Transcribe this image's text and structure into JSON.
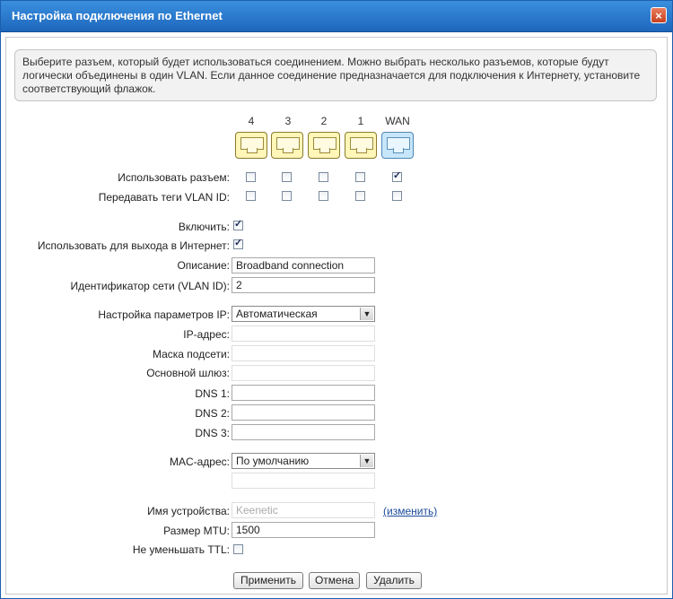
{
  "window": {
    "title": "Настройка подключения по Ethernet",
    "close_label": "×"
  },
  "info": "Выберите разъем, который будет использоваться соединением. Можно выбрать несколько разъемов, которые будут логически объединены в один VLAN. Если данное соединение предназначается для подключения к Интернету, установите соответствующий флажок.",
  "ports": [
    {
      "label": "4",
      "use": false,
      "vlan_tag": false
    },
    {
      "label": "3",
      "use": false,
      "vlan_tag": false
    },
    {
      "label": "2",
      "use": false,
      "vlan_tag": false
    },
    {
      "label": "1",
      "use": false,
      "vlan_tag": false
    },
    {
      "label": "WAN",
      "use": true,
      "vlan_tag": false
    }
  ],
  "labels": {
    "use_port": "Использовать разъем:",
    "vlan_tags": "Передавать теги VLAN ID:",
    "enable": "Включить:",
    "internet": "Использовать для выхода в Интернет:",
    "description": "Описание:",
    "vlan_id": "Идентификатор сети (VLAN ID):",
    "ip_settings": "Настройка параметров IP:",
    "ip_address": "IP-адрес:",
    "subnet_mask": "Маска подсети:",
    "gateway": "Основной шлюз:",
    "dns1": "DNS 1:",
    "dns2": "DNS 2:",
    "dns3": "DNS 3:",
    "mac": "MAC-адрес:",
    "device_name": "Имя устройства:",
    "mtu": "Размер MTU:",
    "ttl": "Не уменьшать TTL:"
  },
  "values": {
    "enable": true,
    "internet": true,
    "ttl": false,
    "description": "Broadband connection",
    "vlan_id": "2",
    "ip_settings": "Автоматическая",
    "mac": "По умолчанию",
    "device_name": "Keenetic",
    "mtu": "1500"
  },
  "change_link": "(изменить)",
  "buttons": {
    "apply": "Применить",
    "cancel": "Отмена",
    "delete": "Удалить"
  }
}
